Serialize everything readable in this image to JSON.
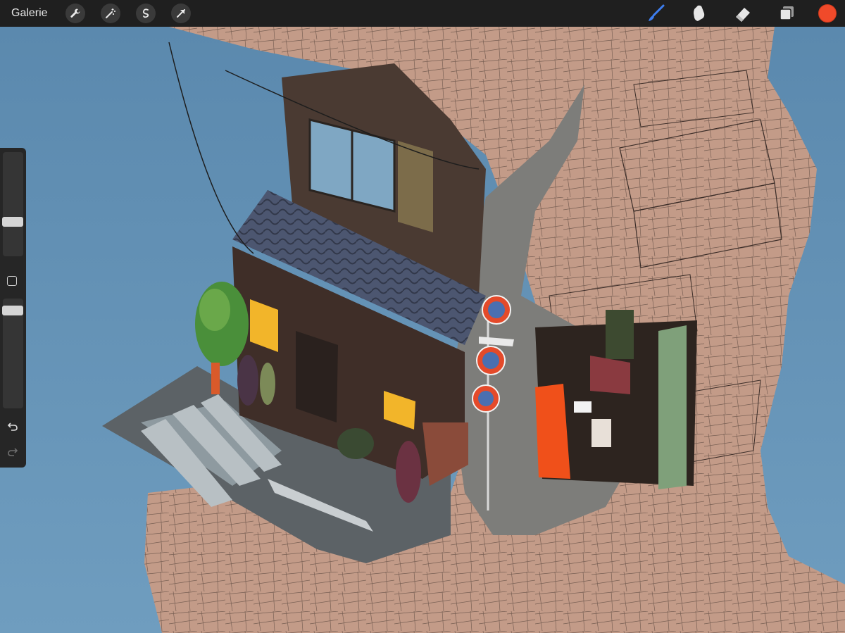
{
  "toolbar": {
    "gallery_label": "Galerie",
    "left_tools": [
      "wrench-icon",
      "magic-wand-icon",
      "selection-icon",
      "transform-icon"
    ],
    "right_tools": [
      "brush-icon",
      "smudge-icon",
      "eraser-icon",
      "layers-icon"
    ],
    "active_tool": "brush",
    "current_color": "#f04a2a"
  },
  "sidebar": {
    "brush_size_level": 0.35,
    "opacity_level": 0.9
  },
  "colors": {
    "sky": "#5b86a8",
    "toolbar": "#1f1f1f",
    "brush_active": "#3d7ef0"
  }
}
